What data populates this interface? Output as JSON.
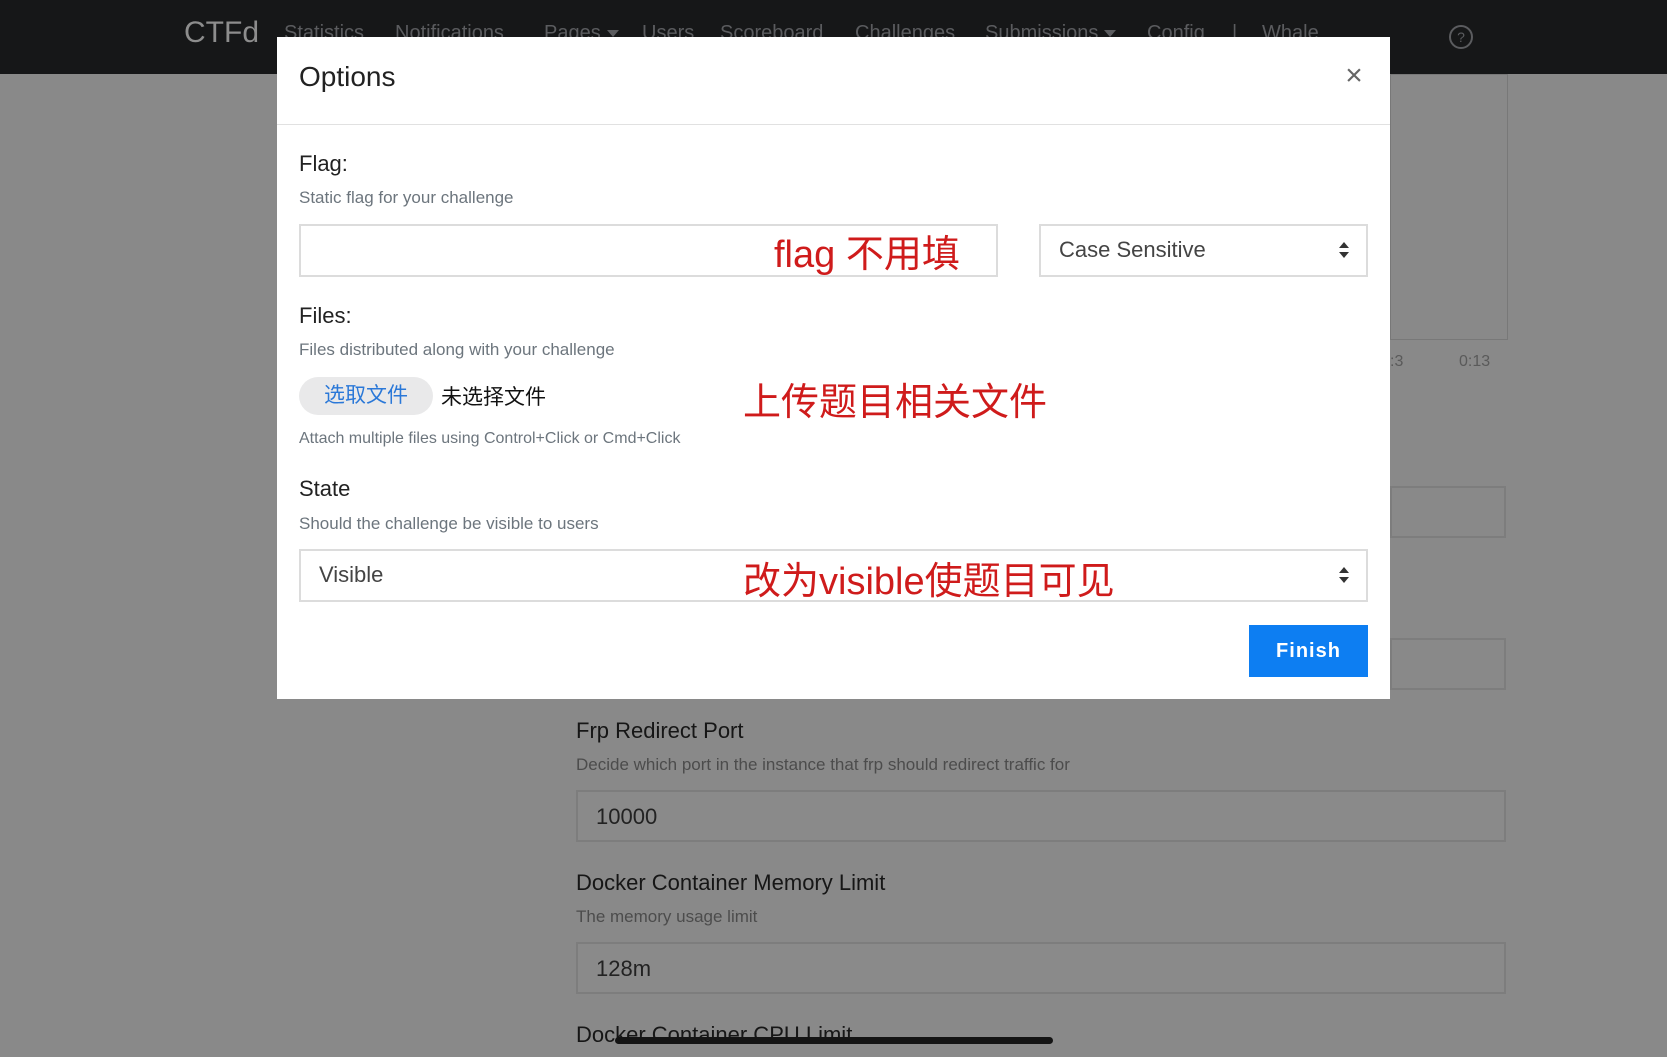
{
  "navbar": {
    "brand": "CTFd",
    "items": [
      "Statistics",
      "Notifications",
      "Pages",
      "Users",
      "Scoreboard",
      "Challenges",
      "Submissions",
      "Config",
      "|",
      "Whale"
    ],
    "help_icon": "question-circle-icon"
  },
  "background": {
    "chart_ticks": [
      ":3",
      "0:13"
    ],
    "fields": [
      {
        "label": "Frp Redirect Port",
        "help": "Decide which port in the instance that frp should redirect traffic for",
        "value": "10000"
      },
      {
        "label": "Docker Container Memory Limit",
        "help": "The memory usage limit",
        "value": "128m"
      },
      {
        "label": "Docker Container CPU Limit"
      }
    ]
  },
  "modal": {
    "title": "Options",
    "close_symbol": "×",
    "flag": {
      "label": "Flag:",
      "help": "Static flag for your challenge",
      "value": "",
      "case_option": "Case Sensitive"
    },
    "files": {
      "label": "Files:",
      "help": "Files distributed along with your challenge",
      "choose_button": "选取文件",
      "status": "未选择文件",
      "attach_help": "Attach multiple files using Control+Click or Cmd+Click"
    },
    "state": {
      "label": "State",
      "help": "Should the challenge be visible to users",
      "value": "Visible"
    },
    "finish_button": "Finish"
  },
  "annotations": {
    "flag_note": "flag 不用填",
    "files_note": "上传题目相关文件",
    "state_note": "改为visible使题目可见",
    "color": "#cf1b1b"
  },
  "colors": {
    "navbar_bg": "#161718",
    "overlay_bg": "#898989",
    "primary": "#0d7ef2",
    "link": "#2a78d8"
  }
}
